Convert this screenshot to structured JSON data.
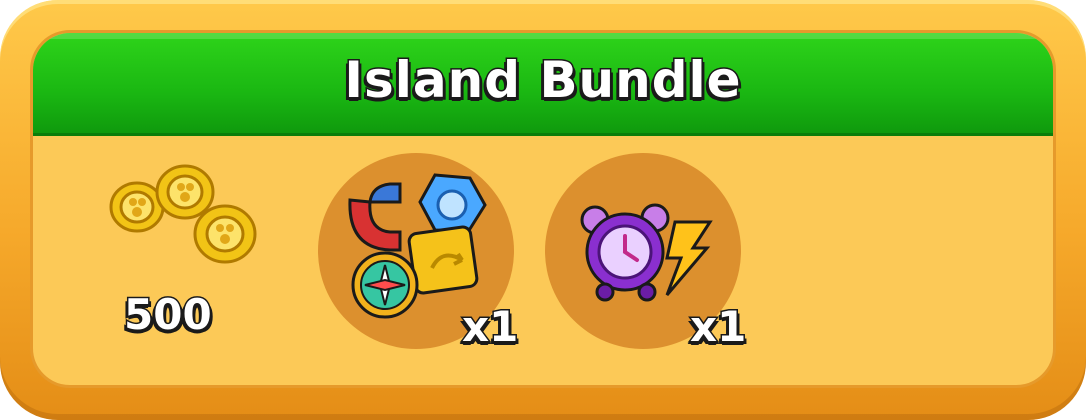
{
  "bundle": {
    "title": "Island Bundle",
    "items": [
      {
        "icon": "coins-icon",
        "amount": "500"
      },
      {
        "icon": "magnet-gem-compass-card-icon",
        "amount": "x1"
      },
      {
        "icon": "alarm-clock-lightning-icon",
        "amount": "x1"
      }
    ]
  },
  "colors": {
    "frame": "#f6a92b",
    "panel": "#fcc957",
    "header": "#1ab712",
    "item_circle": "#dc902e"
  }
}
